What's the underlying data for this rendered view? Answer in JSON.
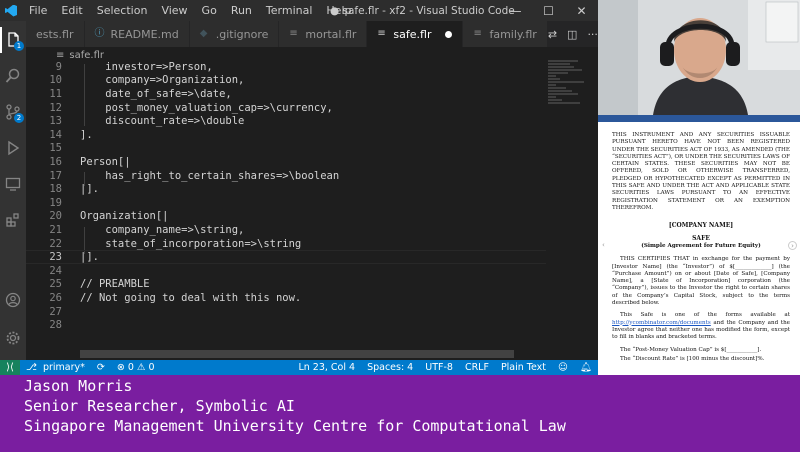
{
  "app": {
    "menu": [
      "File",
      "Edit",
      "Selection",
      "View",
      "Go",
      "Run",
      "Terminal",
      "Help"
    ],
    "window_title": "● safe.flr - xf2 - Visual Studio Code"
  },
  "tabs": [
    {
      "label": "ests.flr",
      "active": false
    },
    {
      "label": "README.md",
      "active": false
    },
    {
      "label": ".gitignore",
      "active": false
    },
    {
      "label": "mortal.flr",
      "active": false
    },
    {
      "label": "safe.flr",
      "active": true,
      "modified": true
    },
    {
      "label": "family.flr",
      "active": false
    }
  ],
  "breadcrumb": {
    "file": "safe.flr"
  },
  "activity_badges": {
    "explorer": "1",
    "scm": "2"
  },
  "editor": {
    "lines": [
      {
        "n": "9",
        "code": "    investor=>Person,"
      },
      {
        "n": "10",
        "code": "    company=>Organization,"
      },
      {
        "n": "11",
        "code": "    date_of_safe=>\\date,"
      },
      {
        "n": "12",
        "code": "    post_money_valuation_cap=>\\currency,"
      },
      {
        "n": "13",
        "code": "    discount_rate=>\\double"
      },
      {
        "n": "14",
        "code": "]."
      },
      {
        "n": "15",
        "code": ""
      },
      {
        "n": "16",
        "code": "Person[|"
      },
      {
        "n": "17",
        "code": "    has_right_to_certain_shares=>\\boolean"
      },
      {
        "n": "18",
        "code": "|]."
      },
      {
        "n": "19",
        "code": ""
      },
      {
        "n": "20",
        "code": "Organization[|"
      },
      {
        "n": "21",
        "code": "    company_name=>\\string,"
      },
      {
        "n": "22",
        "code": "    state_of_incorporation=>\\string"
      },
      {
        "n": "23",
        "code": "|]."
      },
      {
        "n": "24",
        "code": ""
      },
      {
        "n": "25",
        "code": "// PREAMBLE"
      },
      {
        "n": "26",
        "code": "// Not going to deal with this now."
      },
      {
        "n": "27",
        "code": ""
      },
      {
        "n": "28",
        "code": ""
      }
    ],
    "current_line": "23"
  },
  "statusbar": {
    "branch": "primary*",
    "problems": "⊗ 0 ⚠ 0",
    "position": "Ln 23, Col 4",
    "spaces": "Spaces: 4",
    "encoding": "UTF-8",
    "eol": "CRLF",
    "language": "Plain Text"
  },
  "document": {
    "legend": "THIS INSTRUMENT AND ANY SECURITIES ISSUABLE PURSUANT HERETO HAVE NOT BEEN REGISTERED UNDER THE SECURITIES ACT OF 1933, AS AMENDED (THE “SECURITIES ACT”), OR UNDER THE SECURITIES LAWS OF CERTAIN STATES. THESE SECURITIES MAY NOT BE OFFERED, SOLD OR OTHERWISE TRANSFERRED, PLEDGED OR HYPOTHECATED EXCEPT AS PERMITTED IN THIS SAFE AND UNDER THE ACT AND APPLICABLE STATE SECURITIES LAWS PURSUANT TO AN EFFECTIVE REGISTRATION STATEMENT OR AN EXEMPTION THEREFROM.",
    "company": "[COMPANY NAME]",
    "title": "SAFE",
    "subtitle": "(Simple Agreement for Future Equity)",
    "para1": "THIS CERTIFIES THAT in exchange for the payment by [Investor Name] (the “Investor”) of $[_____________] (the “Purchase Amount”) on or about [Date of Safe], [Company Name], a [State of Incorporation] corporation (the “Company”), issues to the Investor the right to certain shares of the Company’s Capital Stock, subject to the terms described below.",
    "para2_pre": "This Safe is one of the forms available at ",
    "para2_link": "http://ycombinator.com/documents",
    "para2_post": " and the Company and the Investor agree that neither one has modified the form, except to fill in blanks and bracketed terms.",
    "cap": "The “Post-Money Valuation Cap” is $[___________].",
    "discount": "The “Discount Rate” is [100 minus the discount]%."
  },
  "lower_third": {
    "name": "Jason Morris",
    "role": "Senior Researcher, Symbolic AI",
    "org": "Singapore Management University Centre for Computational Law"
  },
  "colors": {
    "statusbar": "#007acc",
    "lower_third": "#7a1ea0",
    "activitybar": "#333333",
    "editor_bg": "#1e1e1e"
  }
}
